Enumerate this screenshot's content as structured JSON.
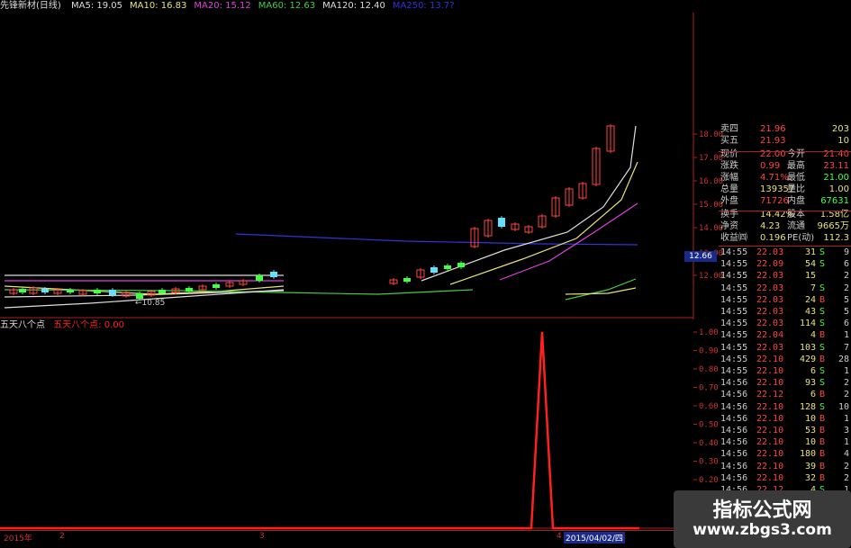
{
  "legend": {
    "title": "先锋新材(日线)",
    "items": [
      {
        "label": "MA5: 19.05",
        "color": "#dddddd"
      },
      {
        "label": "MA10: 16.83",
        "color": "#e8e27a"
      },
      {
        "label": "MA20: 15.12",
        "color": "#e040e0"
      },
      {
        "label": "MA60: 12.63",
        "color": "#44cc44"
      },
      {
        "label": "MA120: 12.40",
        "color": "#dddddd"
      },
      {
        "label": "MA250: 13.7?",
        "color": "#3333dd"
      }
    ]
  },
  "price_axis": [
    "18.00",
    "17.00",
    "16.00",
    "15.00",
    "14.00",
    "13.00",
    "12.00"
  ],
  "current_price_tag": "12.66",
  "low_annotation": "10.85",
  "sub_legend": {
    "name": "五天八个点",
    "value_label": "五天八个点: 0.00"
  },
  "sub_axis": [
    "1.00",
    "0.90",
    "0.80",
    "0.70",
    "0.60",
    "0.50",
    "0.40",
    "0.30",
    "0.20",
    "0.10"
  ],
  "bottom": {
    "year_label": "2015年",
    "date_label": "2015/04/02/四",
    "marks": [
      "2",
      "3",
      "4"
    ]
  },
  "quote": {
    "ask": [
      {
        "label": "卖四",
        "price": "21.96",
        "vol": "203"
      },
      {
        "label": "买五",
        "price": "21.93",
        "vol": "10"
      }
    ],
    "fields": [
      {
        "l1": "现价",
        "v1": "22.00",
        "l2": "今开",
        "v2": "21.40",
        "c1": "#ff4444",
        "c2": "#ff4444"
      },
      {
        "l1": "涨跌",
        "v1": "0.99",
        "l2": "最高",
        "v2": "23.11",
        "c1": "#ff4444",
        "c2": "#ff4444"
      },
      {
        "l1": "涨幅",
        "v1": "4.71%",
        "l2": "最低",
        "v2": "21.00",
        "c1": "#ff4444",
        "c2": "#44ff44"
      },
      {
        "l1": "总量",
        "v1": "139357",
        "l2": "量比",
        "v2": "1.00",
        "c1": "#e8e27a",
        "c2": "#e8e27a"
      },
      {
        "l1": "外盘",
        "v1": "71726",
        "l2": "内盘",
        "v2": "67631",
        "c1": "#ff4444",
        "c2": "#44ff44"
      }
    ],
    "stats": [
      {
        "l1": "换手",
        "v1": "14.42%",
        "l2": "股本",
        "v2": "1.58亿"
      },
      {
        "l1": "净资",
        "v1": "4.23",
        "l2": "流通",
        "v2": "9665万"
      },
      {
        "l1": "收益㈣",
        "v1": "0.196",
        "l2": "PE(动)",
        "v2": "112.3"
      }
    ]
  },
  "trades": [
    {
      "time": "14:55",
      "price": "22.03",
      "vol": "31",
      "side": "S",
      "n": "9"
    },
    {
      "time": "14:55",
      "price": "22.09",
      "vol": "54",
      "side": "S",
      "n": "6"
    },
    {
      "time": "14:55",
      "price": "22.03",
      "vol": "15",
      "side": "",
      "n": "2"
    },
    {
      "time": "14:55",
      "price": "22.03",
      "vol": "7",
      "side": "S",
      "n": "2"
    },
    {
      "time": "14:55",
      "price": "22.03",
      "vol": "24",
      "side": "B",
      "n": "5"
    },
    {
      "time": "14:55",
      "price": "22.03",
      "vol": "43",
      "side": "S",
      "n": "5"
    },
    {
      "time": "14:55",
      "price": "22.03",
      "vol": "114",
      "side": "S",
      "n": "6"
    },
    {
      "time": "14:55",
      "price": "22.04",
      "vol": "4",
      "side": "B",
      "n": "1"
    },
    {
      "time": "14:55",
      "price": "22.03",
      "vol": "103",
      "side": "S",
      "n": "7"
    },
    {
      "time": "14:55",
      "price": "22.10",
      "vol": "429",
      "side": "B",
      "n": "28"
    },
    {
      "time": "14:55",
      "price": "22.10",
      "vol": "6",
      "side": "S",
      "n": "1"
    },
    {
      "time": "14:56",
      "price": "22.10",
      "vol": "93",
      "side": "S",
      "n": "2"
    },
    {
      "time": "14:56",
      "price": "22.12",
      "vol": "6",
      "side": "B",
      "n": "2"
    },
    {
      "time": "14:56",
      "price": "22.10",
      "vol": "128",
      "side": "S",
      "n": "10"
    },
    {
      "time": "14:56",
      "price": "22.10",
      "vol": "10",
      "side": "B",
      "n": "1"
    },
    {
      "time": "14:56",
      "price": "22.10",
      "vol": "53",
      "side": "B",
      "n": "3"
    },
    {
      "time": "14:56",
      "price": "22.10",
      "vol": "10",
      "side": "B",
      "n": "1"
    },
    {
      "time": "14:56",
      "price": "22.10",
      "vol": "180",
      "side": "B",
      "n": "4"
    },
    {
      "time": "14:56",
      "price": "22.10",
      "vol": "39",
      "side": "B",
      "n": "2"
    },
    {
      "time": "14:56",
      "price": "22.10",
      "vol": "32",
      "side": "B",
      "n": "2"
    },
    {
      "time": "14:56",
      "price": "22.12",
      "vol": "4",
      "side": "S",
      "n": "1"
    },
    {
      "time": "14:56",
      "price": "22.12",
      "vol": "34",
      "side": "B",
      "n": "5"
    }
  ],
  "watermark": {
    "title": "指标公式网",
    "url": "www.zbgs3.com"
  },
  "colors": {
    "up": "#ff4444",
    "down": "#44ff44",
    "neutral": "#e8e27a",
    "axis": "#aa2222",
    "signal": "#ff2020",
    "doji": "#66e0ff"
  }
}
